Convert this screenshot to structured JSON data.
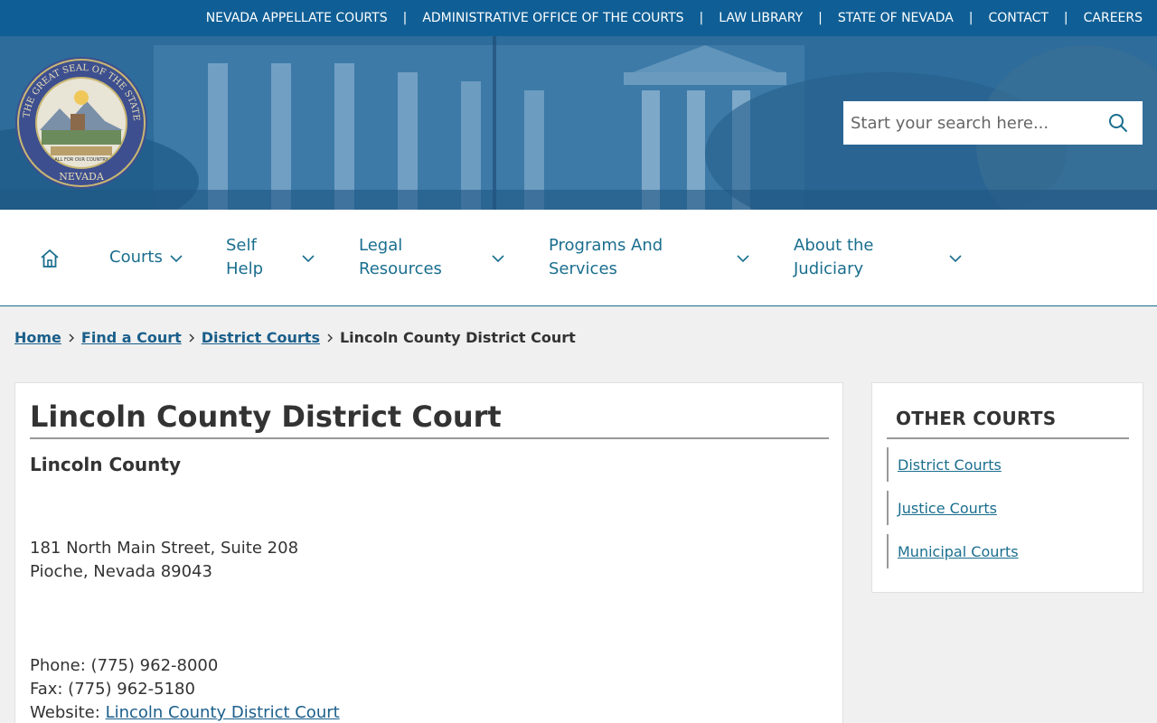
{
  "topbar": {
    "links": [
      "NEVADA APPELLATE COURTS",
      "ADMINISTRATIVE OFFICE OF THE COURTS",
      "LAW LIBRARY",
      "STATE OF NEVADA",
      "CONTACT",
      "CAREERS"
    ],
    "separator": "|"
  },
  "header": {
    "search_placeholder": "Start your search here...",
    "seal_text": "THE GREAT SEAL OF THE STATE OF NEVADA",
    "seal_motto": "ALL FOR OUR COUNTRY"
  },
  "nav": {
    "items": [
      {
        "line1": "Courts",
        "line2": ""
      },
      {
        "line1": "Self",
        "line2": "Help"
      },
      {
        "line1": "Legal",
        "line2": "Resources"
      },
      {
        "line1": "Programs And",
        "line2": "Services"
      },
      {
        "line1": "About the",
        "line2": "Judiciary"
      }
    ]
  },
  "breadcrumb": {
    "items": [
      "Home",
      "Find a Court",
      "District Courts"
    ],
    "current": "Lincoln County District Court"
  },
  "court": {
    "title": "Lincoln County District Court",
    "county": "Lincoln County",
    "address_line1": "181 North Main Street, Suite 208",
    "address_line2": "Pioche, Nevada 89043",
    "phone": "Phone: (775) 962-8000",
    "fax": "Fax: (775) 962-5180",
    "website_label": "Website:",
    "website_link": "Lincoln County District Court"
  },
  "sidebar": {
    "title": "OTHER COURTS",
    "items": [
      "District Courts",
      "Justice Courts",
      "Municipal Courts"
    ]
  },
  "colors": {
    "topbar": "#0f5f96",
    "nav_text": "#1a6e8e",
    "link": "#1a5e8a",
    "background": "#f0f0f0"
  }
}
